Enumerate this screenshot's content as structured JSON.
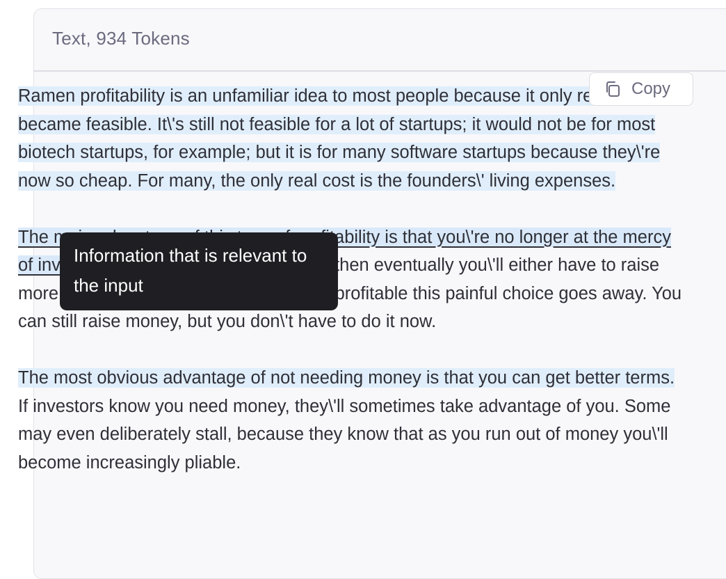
{
  "panel": {
    "title": "Text, 934 Tokens"
  },
  "copy_button": {
    "label": "Copy",
    "icon": "copy-icon"
  },
  "tooltip": {
    "text": "Information that is relevant to the input"
  },
  "paragraphs": [
    {
      "segments": [
        {
          "text": "Ramen profitability is an unfamiliar idea to most people because it only recently became feasible. It\\'s still not feasible for a lot of startups; it would not be for most biotech startups, for example; but it is for many software startups because they\\'re now so cheap. For many, the only real cost is the founders\\' living expenses.",
          "highlight": true
        }
      ]
    },
    {
      "segments": [
        {
          "text": "The main advantage of this type of profitability is that you\\'re no longer at the mercy of investors.",
          "highlight": true,
          "active": true
        },
        {
          "text": " If you\\'re still losing money, then eventually you\\'ll either have to raise more or shut down. Once you\\'re ramen profitable this painful choice goes away. You can still raise money, but you don\\'t have to do it now.",
          "highlight": false
        }
      ]
    },
    {
      "segments": [
        {
          "text": "The most obvious advantage of not needing money is that you can get better terms.",
          "highlight": true
        },
        {
          "text": " If investors know you need money, they\\'ll sometimes take advantage of you. Some may even deliberately stall, because they know that as you run out of money you\\'ll become increasingly pliable.",
          "highlight": false
        }
      ]
    }
  ],
  "colors": {
    "highlight": "#e0eefb",
    "tooltip_bg": "#1e1e23",
    "panel_bg": "#f8f8fb"
  }
}
